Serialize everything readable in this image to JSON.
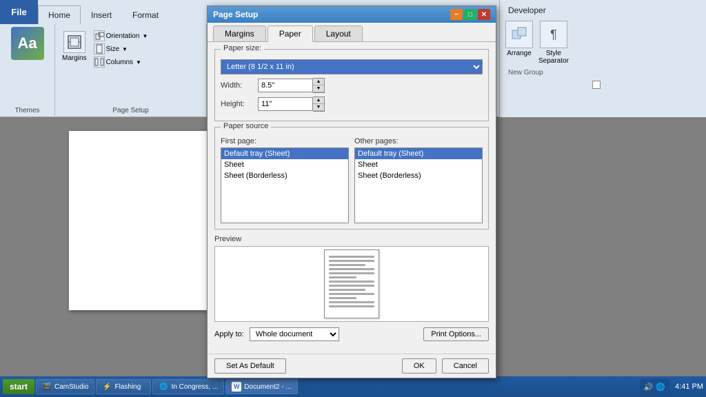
{
  "ribbon": {
    "file_label": "File",
    "tabs": [
      "Home",
      "Insert",
      "Format"
    ],
    "active_tab": "Home",
    "groups": {
      "themes": {
        "label": "Themes",
        "icon": "Aa"
      },
      "page_setup": {
        "label": "Page Setup",
        "orientation_label": "Orientation",
        "size_label": "Size",
        "columns_label": "Columns",
        "margins_label": "Margins"
      }
    },
    "developer": {
      "label": "Developer",
      "arrange_label": "Arrange",
      "style_separator_label": "Style\nSeparator",
      "new_group_label": "New Group"
    }
  },
  "dialog": {
    "title": "Page Setup",
    "tabs": [
      "Margins",
      "Paper",
      "Layout"
    ],
    "active_tab": "Paper",
    "paper": {
      "size_label": "Paper size:",
      "size_value": "Letter (8 1/2 x 11 in)",
      "width_label": "Width:",
      "width_value": "8.5\"",
      "height_label": "Height:",
      "height_value": "11\"",
      "source_label": "Paper source",
      "first_page_label": "First page:",
      "other_pages_label": "Other pages:",
      "first_page_items": [
        "Default tray (Sheet)",
        "Sheet",
        "Sheet (Borderless)"
      ],
      "other_page_items": [
        "Default tray (Sheet)",
        "Sheet",
        "Sheet (Borderless)"
      ],
      "preview_label": "Preview",
      "apply_to_label": "Apply to:",
      "apply_to_value": "Whole document",
      "print_options_label": "Print Options...",
      "set_default_label": "Set As Default",
      "ok_label": "OK",
      "cancel_label": "Cancel"
    }
  },
  "taskbar": {
    "start_label": "start",
    "items": [
      {
        "icon": "🎬",
        "text": "CamStudio"
      },
      {
        "icon": "⚡",
        "text": "Flashing"
      },
      {
        "icon": "🌐",
        "text": "In Congress, ..."
      },
      {
        "icon": "W",
        "text": "Document2 - ..."
      }
    ],
    "clock": "4:41 PM",
    "tray_icons": [
      "🔊",
      "🌐",
      "⚙"
    ]
  }
}
